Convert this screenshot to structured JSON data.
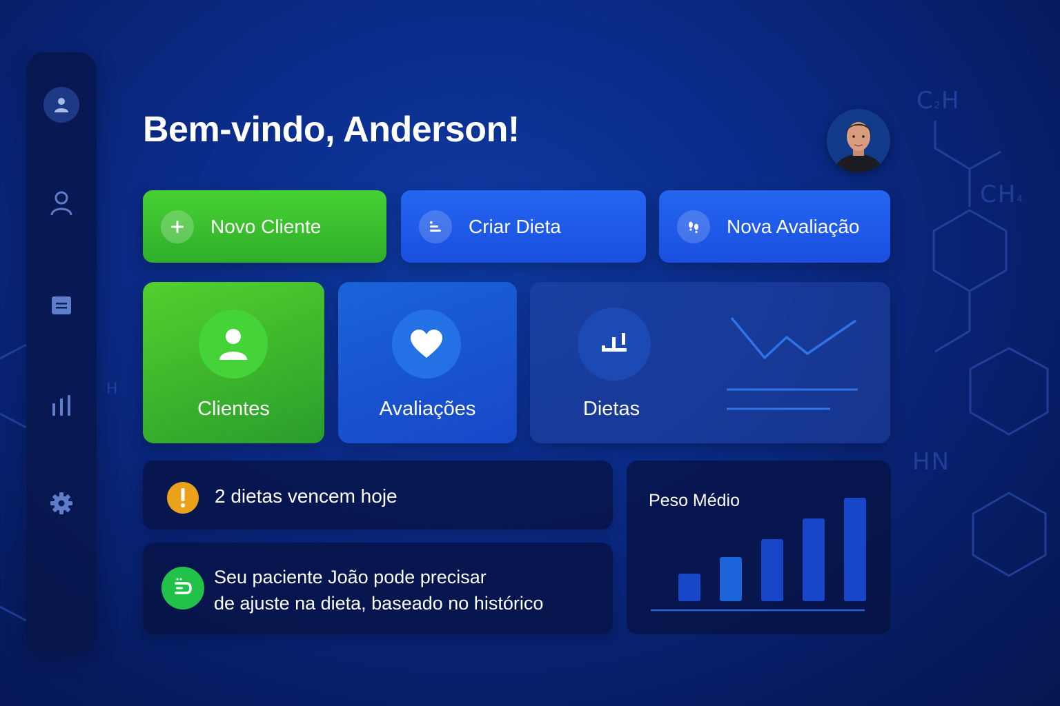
{
  "header": {
    "greeting": "Bem-vindo, Anderson!"
  },
  "sidebar": {
    "items": [
      {
        "name": "profile",
        "icon": "user-circle-icon",
        "active": true
      },
      {
        "name": "clients",
        "icon": "user-icon"
      },
      {
        "name": "documents",
        "icon": "document-icon"
      },
      {
        "name": "reports",
        "icon": "bar-chart-icon"
      },
      {
        "name": "settings",
        "icon": "gear-icon"
      }
    ]
  },
  "actions": [
    {
      "label": "Novo Cliente",
      "icon": "plus-icon",
      "color": "#3bc22f"
    },
    {
      "label": "Criar Dieta",
      "icon": "list-icon",
      "color": "#1f5ae8"
    },
    {
      "label": "Nova Avaliação",
      "icon": "footprints-icon",
      "color": "#1f5ae8"
    }
  ],
  "tiles": [
    {
      "label": "Clientes",
      "icon": "user-icon"
    },
    {
      "label": "Avaliações",
      "icon": "heart-icon"
    },
    {
      "label": "Dietas",
      "icon": "chart-icon"
    }
  ],
  "alerts": {
    "due_text": "2 dietas vencem hoje",
    "suggestion_line1": "Seu paciente João pode precisar",
    "suggestion_line2": "de ajuste na dieta, baseado no histórico"
  },
  "chart_data": {
    "type": "bar",
    "title": "Peso Médio",
    "values": [
      2,
      3.2,
      4.5,
      6,
      7.5
    ],
    "ylim": [
      0,
      8
    ],
    "colors": [
      "#1747c8",
      "#1a63d8",
      "#1747c8",
      "#1747c8",
      "#1747c8"
    ]
  },
  "colors": {
    "accent_green": "#3bc22f",
    "accent_blue": "#1f5ae8",
    "warning": "#e9a21a",
    "background": "#0a2a86"
  }
}
